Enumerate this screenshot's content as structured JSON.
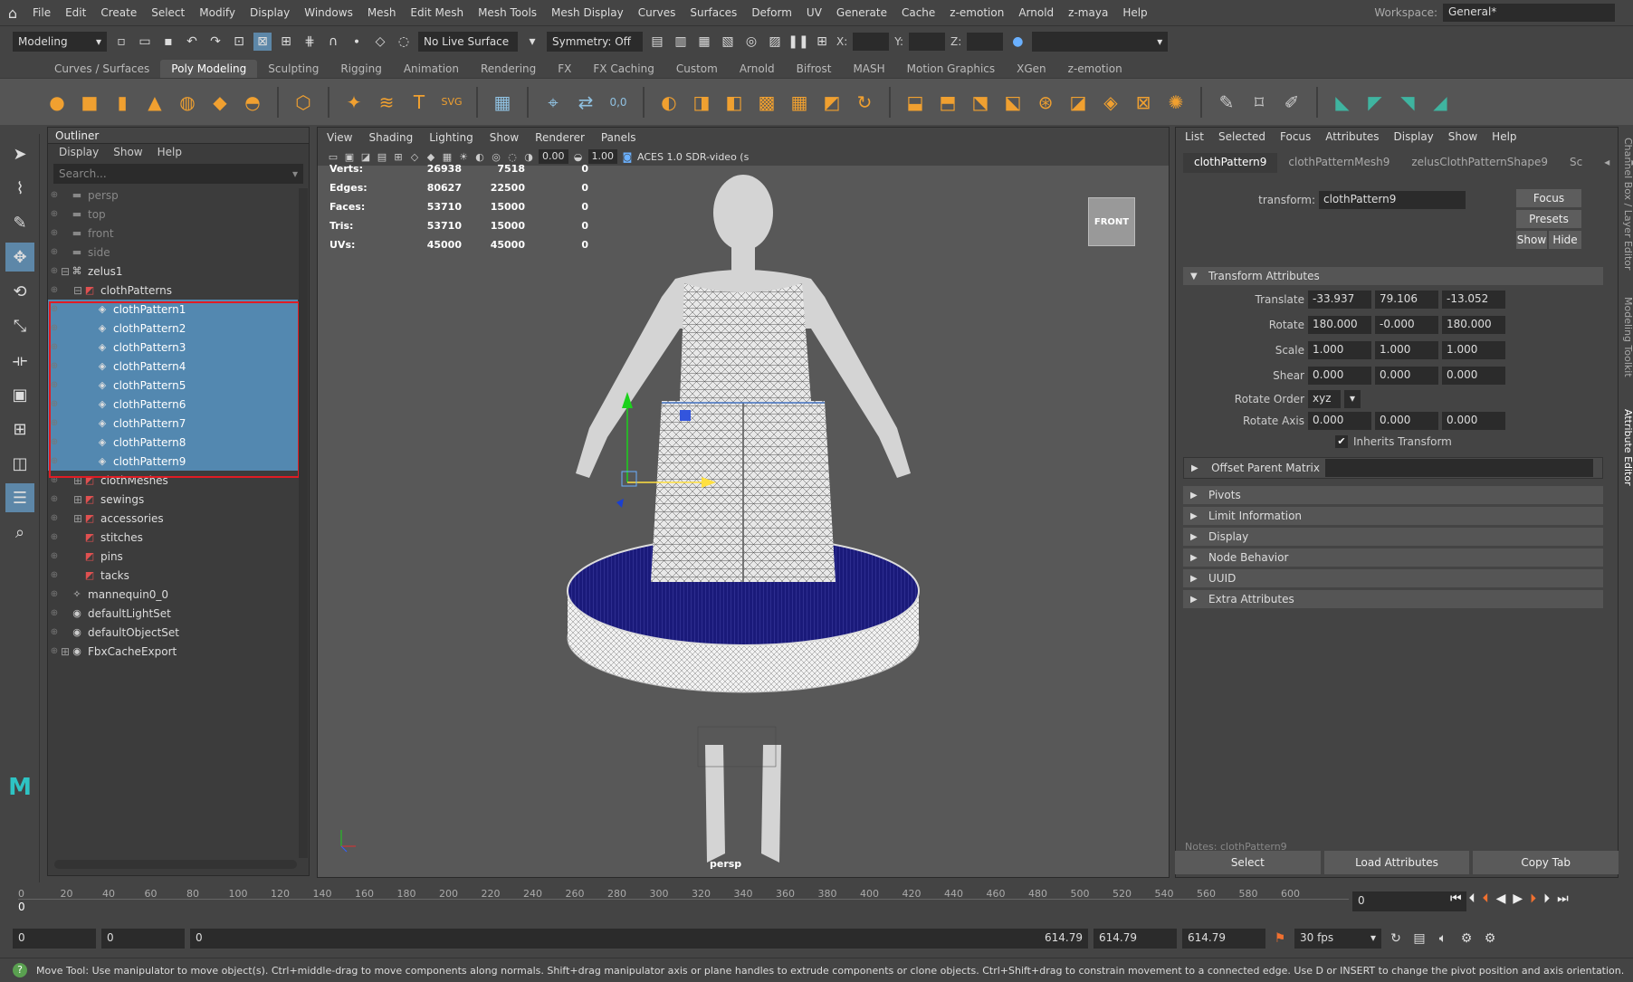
{
  "menubar": {
    "items": [
      "File",
      "Edit",
      "Create",
      "Select",
      "Modify",
      "Display",
      "Windows",
      "Mesh",
      "Edit Mesh",
      "Mesh Tools",
      "Mesh Display",
      "Curves",
      "Surfaces",
      "Deform",
      "UV",
      "Generate",
      "Cache",
      "z-emotion",
      "Arnold",
      "z-maya",
      "Help"
    ],
    "workspace_label": "Workspace:",
    "workspace_value": "General*"
  },
  "statusline": {
    "mode": "Modeling",
    "live_surface": "No Live Surface",
    "symmetry": "Symmetry: Off",
    "x_label": "X:",
    "y_label": "Y:",
    "z_label": "Z:"
  },
  "shelf": {
    "tabs": [
      "Curves / Surfaces",
      "Poly Modeling",
      "Sculpting",
      "Rigging",
      "Animation",
      "Rendering",
      "FX",
      "FX Caching",
      "Custom",
      "Arnold",
      "Bifrost",
      "MASH",
      "Motion Graphics",
      "XGen",
      "z-emotion"
    ],
    "active_tab": "Poly Modeling"
  },
  "outliner": {
    "title": "Outliner",
    "menu": [
      "Display",
      "Show",
      "Help"
    ],
    "search_placeholder": "Search...",
    "items": [
      {
        "label": "persp",
        "indent": 1,
        "icon": "camera-icon",
        "dim": true,
        "sel": false,
        "expand": ""
      },
      {
        "label": "top",
        "indent": 1,
        "icon": "camera-icon",
        "dim": true,
        "sel": false,
        "expand": ""
      },
      {
        "label": "front",
        "indent": 1,
        "icon": "camera-icon",
        "dim": true,
        "sel": false,
        "expand": ""
      },
      {
        "label": "side",
        "indent": 1,
        "icon": "camera-icon",
        "dim": true,
        "sel": false,
        "expand": ""
      },
      {
        "label": "zelus1",
        "indent": 1,
        "icon": "group-icon",
        "dim": false,
        "sel": false,
        "expand": "⊟"
      },
      {
        "label": "clothPatterns",
        "indent": 2,
        "icon": "pattern-folder-icon",
        "dim": false,
        "sel": false,
        "expand": "⊟"
      },
      {
        "label": "clothPattern1",
        "indent": 3,
        "icon": "mesh-icon",
        "dim": false,
        "sel": true,
        "expand": ""
      },
      {
        "label": "clothPattern2",
        "indent": 3,
        "icon": "mesh-icon",
        "dim": false,
        "sel": true,
        "expand": ""
      },
      {
        "label": "clothPattern3",
        "indent": 3,
        "icon": "mesh-icon",
        "dim": false,
        "sel": true,
        "expand": ""
      },
      {
        "label": "clothPattern4",
        "indent": 3,
        "icon": "mesh-icon",
        "dim": false,
        "sel": true,
        "expand": ""
      },
      {
        "label": "clothPattern5",
        "indent": 3,
        "icon": "mesh-icon",
        "dim": false,
        "sel": true,
        "expand": ""
      },
      {
        "label": "clothPattern6",
        "indent": 3,
        "icon": "mesh-icon",
        "dim": false,
        "sel": true,
        "expand": ""
      },
      {
        "label": "clothPattern7",
        "indent": 3,
        "icon": "mesh-icon",
        "dim": false,
        "sel": true,
        "expand": ""
      },
      {
        "label": "clothPattern8",
        "indent": 3,
        "icon": "mesh-icon",
        "dim": false,
        "sel": true,
        "expand": ""
      },
      {
        "label": "clothPattern9",
        "indent": 3,
        "icon": "mesh-icon",
        "dim": false,
        "sel": true,
        "expand": ""
      },
      {
        "label": "clothMeshes",
        "indent": 2,
        "icon": "pattern-folder-icon",
        "dim": false,
        "sel": false,
        "expand": "⊞"
      },
      {
        "label": "sewings",
        "indent": 2,
        "icon": "pattern-folder-icon",
        "dim": false,
        "sel": false,
        "expand": "⊞"
      },
      {
        "label": "accessories",
        "indent": 2,
        "icon": "pattern-folder-icon",
        "dim": false,
        "sel": false,
        "expand": "⊞"
      },
      {
        "label": "stitches",
        "indent": 2,
        "icon": "pattern-folder-icon",
        "dim": false,
        "sel": false,
        "expand": ""
      },
      {
        "label": "pins",
        "indent": 2,
        "icon": "pattern-folder-icon",
        "dim": false,
        "sel": false,
        "expand": ""
      },
      {
        "label": "tacks",
        "indent": 2,
        "icon": "pattern-folder-icon",
        "dim": false,
        "sel": false,
        "expand": ""
      },
      {
        "label": "mannequin0_0",
        "indent": 1,
        "icon": "mannequin-icon",
        "dim": false,
        "sel": false,
        "expand": ""
      },
      {
        "label": "defaultLightSet",
        "indent": 1,
        "icon": "set-icon",
        "dim": false,
        "sel": false,
        "expand": ""
      },
      {
        "label": "defaultObjectSet",
        "indent": 1,
        "icon": "set-icon",
        "dim": false,
        "sel": false,
        "expand": ""
      },
      {
        "label": "FbxCacheExport",
        "indent": 1,
        "icon": "set-icon",
        "dim": false,
        "sel": false,
        "expand": "⊞"
      }
    ]
  },
  "viewport": {
    "menu": [
      "View",
      "Shading",
      "Lighting",
      "Show",
      "Renderer",
      "Panels"
    ],
    "field1": "0.00",
    "field2": "1.00",
    "color_space": "ACES 1.0 SDR-video (s",
    "hud": [
      {
        "label": "Verts:",
        "a": "26938",
        "b": "7518",
        "c": "0"
      },
      {
        "label": "Edges:",
        "a": "80627",
        "b": "22500",
        "c": "0"
      },
      {
        "label": "Faces:",
        "a": "53710",
        "b": "15000",
        "c": "0"
      },
      {
        "label": "Tris:",
        "a": "53710",
        "b": "15000",
        "c": "0"
      },
      {
        "label": "UVs:",
        "a": "45000",
        "b": "45000",
        "c": "0"
      }
    ],
    "view_cube": "FRONT",
    "camera": "persp"
  },
  "attribute_editor": {
    "menu": [
      "List",
      "Selected",
      "Focus",
      "Attributes",
      "Display",
      "Show",
      "Help"
    ],
    "tabs": [
      "clothPattern9",
      "clothPatternMesh9",
      "zelusClothPatternShape9",
      "Sc"
    ],
    "transform_label": "transform:",
    "transform_value": "clothPattern9",
    "focus": "Focus",
    "presets": "Presets",
    "show": "Show",
    "hide": "Hide",
    "section_transform": "Transform Attributes",
    "translate_label": "Translate",
    "translate": [
      "-33.937",
      "79.106",
      "-13.052"
    ],
    "rotate_label": "Rotate",
    "rotate": [
      "180.000",
      "-0.000",
      "180.000"
    ],
    "scale_label": "Scale",
    "scale": [
      "1.000",
      "1.000",
      "1.000"
    ],
    "shear_label": "Shear",
    "shear": [
      "0.000",
      "0.000",
      "0.000"
    ],
    "rotate_order_label": "Rotate Order",
    "rotate_order": "xyz",
    "rotate_axis_label": "Rotate Axis",
    "rotate_axis": [
      "0.000",
      "0.000",
      "0.000"
    ],
    "inherits_transform": "Inherits Transform",
    "offset_parent_matrix": "Offset Parent Matrix",
    "sections": [
      "Pivots",
      "Limit Information",
      "Display",
      "Node Behavior",
      "UUID",
      "Extra Attributes"
    ],
    "notes": "Notes: clothPattern9",
    "select_btn": "Select",
    "load_btn": "Load Attributes",
    "copy_btn": "Copy Tab",
    "side_tabs": [
      "Channel Box / Layer Editor",
      "Modeling Toolkit",
      "Attribute Editor"
    ]
  },
  "timeline": {
    "ticks": [
      "0",
      "20",
      "40",
      "60",
      "80",
      "100",
      "120",
      "140",
      "160",
      "180",
      "200",
      "220",
      "240",
      "260",
      "280",
      "300",
      "320",
      "340",
      "360",
      "380",
      "400",
      "420",
      "440",
      "460",
      "480",
      "500",
      "520",
      "540",
      "560",
      "580",
      "600"
    ],
    "current_frame_field": "0",
    "current_frame": "0",
    "range_start": "0",
    "range_start2": "0",
    "range_slider_start": "0",
    "range_slider_end": "614.79",
    "range_end": "614.79",
    "range_end2": "614.79",
    "fps": "30 fps"
  },
  "helpline": "Move Tool: Use manipulator to move object(s). Ctrl+middle-drag to move components along normals. Shift+drag manipulator axis or plane handles to extrude components or clone objects. Ctrl+Shift+drag to constrain movement to a connected edge. Use D or INSERT to change the pivot position and axis orientation.",
  "colors": {
    "selection": "#5388b0",
    "highlight_box": "#e01c24",
    "accent": "#5d87a8"
  }
}
